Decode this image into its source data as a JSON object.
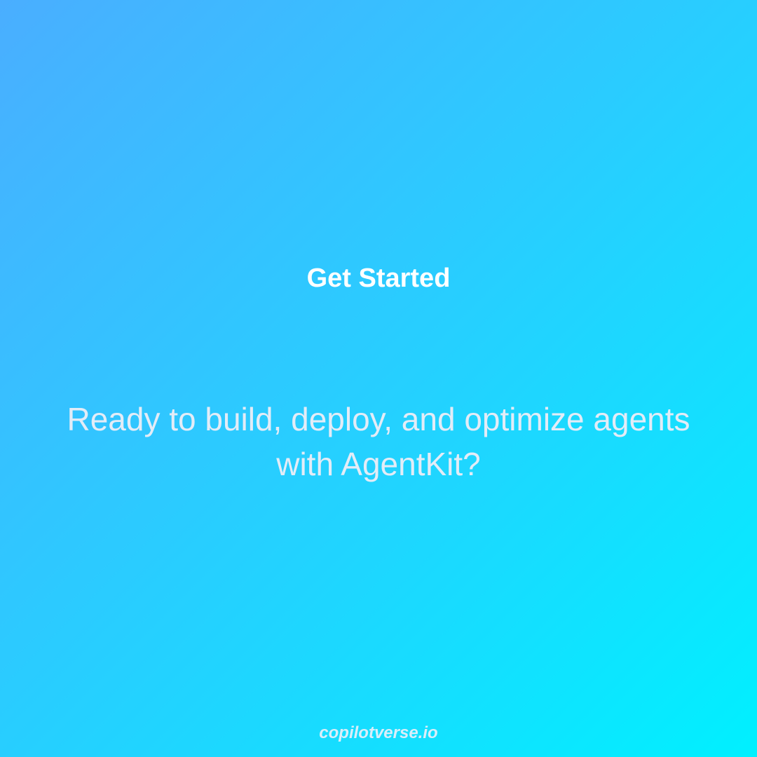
{
  "slide": {
    "heading": "Get Started",
    "body": "Ready to build, deploy, and optimize agents with AgentKit?",
    "footer": "copilotverse.io"
  },
  "colors": {
    "gradient_start": "#4aaeff",
    "gradient_mid": "#2bcbff",
    "gradient_end": "#00f0ff",
    "heading": "#ffffff",
    "body": "#e3ecf7",
    "footer": "#d9eefa"
  }
}
